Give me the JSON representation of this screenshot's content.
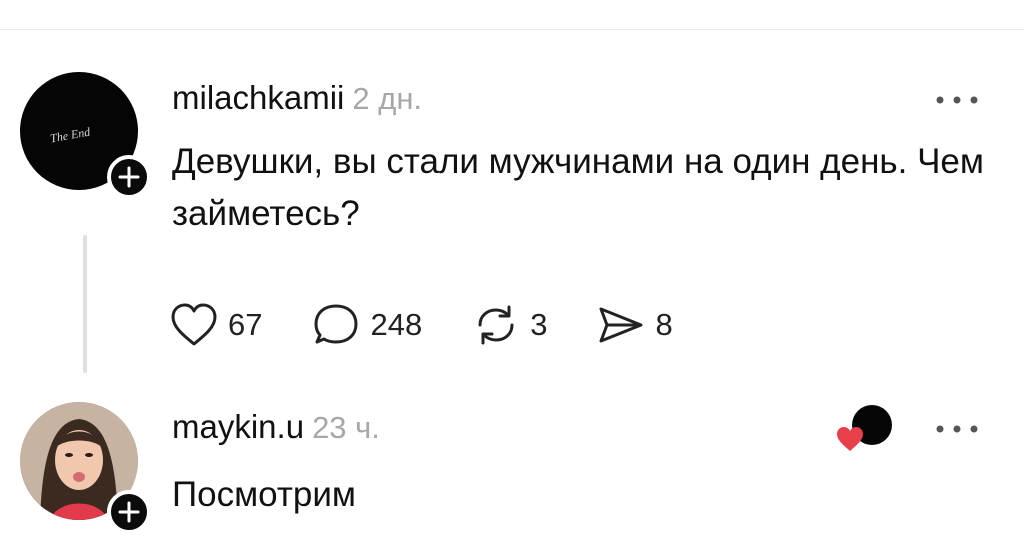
{
  "posts": [
    {
      "avatar_text": "The End",
      "username": "milachkamii",
      "time": "2 дн.",
      "text": "Девушки, вы стали мужчинами на один день. Чем займетесь?",
      "actions": {
        "likes": "67",
        "comments": "248",
        "reposts": "3",
        "shares": "8"
      }
    },
    {
      "username": "maykin.u",
      "time": "23 ч.",
      "text": "Посмотрим"
    }
  ],
  "icons": [
    "plus-icon",
    "more-icon",
    "heart-icon",
    "comment-icon",
    "repost-icon",
    "send-icon"
  ],
  "colors": {
    "text": "#111111",
    "muted": "#a7a7a7",
    "like": "#e8404a",
    "divider": "#e9e9e9"
  }
}
